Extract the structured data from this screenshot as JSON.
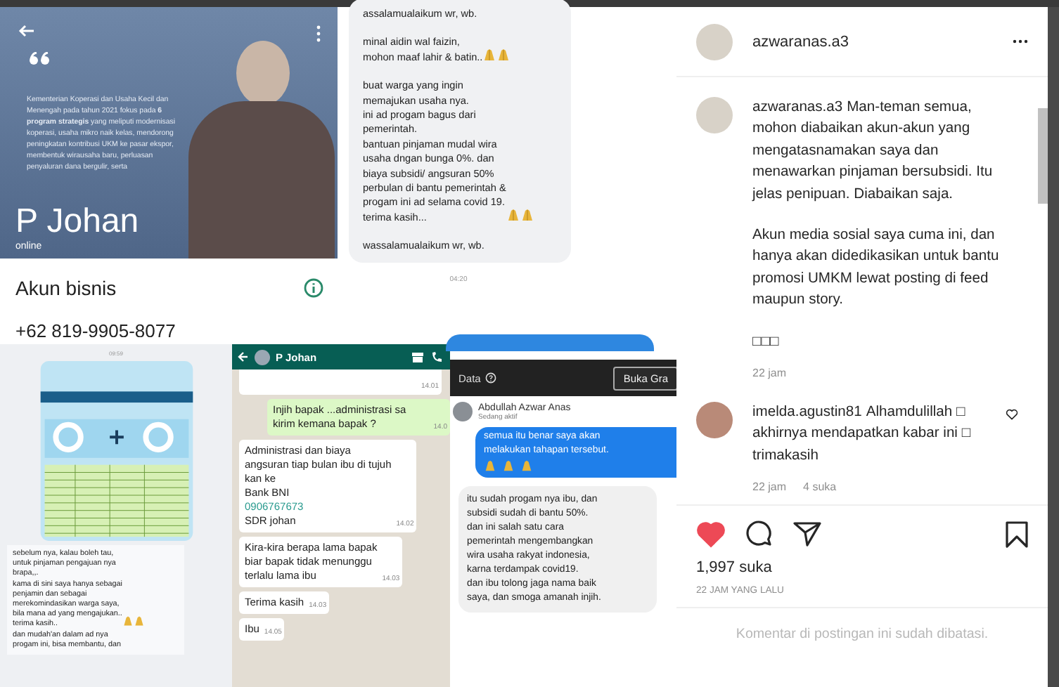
{
  "post_image": {
    "profile_card": {
      "quote": "Kementerian Koperasi dan Usaha Kecil dan Menengah pada tahun 2021 fokus pada **6 program strategis** yang meliputi modernisasi koperasi, usaha mikro naik kelas, mendorong peningkatan kontribusi UKM ke pasar ekspor, membentuk wirausaha baru, perluasan penyaluran dana bergulir, serta",
      "name": "P Johan",
      "status": "online",
      "section_title": "Akun bisnis",
      "phone": "+62 819-9905-8077"
    },
    "message_card": {
      "paragraphs": [
        {
          "lines": [
            "assalamualaikum wr, wb."
          ]
        },
        {
          "lines": [
            "minal aidin wal faizin,",
            "mohon maaf lahir & batin.."
          ],
          "icons": [
            {
              "kind": "pray"
            },
            {
              "kind": "pray"
            }
          ]
        },
        {
          "lines": [
            "buat warga yang ingin",
            "memajukan usaha nya.",
            "ini ad progam bagus dari",
            "pemerintah.",
            "bantuan pinjaman mudal wira",
            "usaha dngan bunga 0%. dan",
            "biaya subsidi/ angsuran 50%",
            "perbulan di bantu pemerintah &",
            "progam ini ad selama covid 19.",
            "terima kasih..."
          ],
          "icons": [
            {
              "kind": "pray"
            },
            {
              "kind": "pray"
            }
          ]
        },
        {
          "lines": [
            "wassalamualaikum wr, wb."
          ]
        }
      ],
      "time": "04:20"
    },
    "request_card": {
      "time": "09:59",
      "paragraphs": [
        {
          "lines": [
            "sebelum nya, kalau boleh tau,",
            "untuk pinjaman pengajuan nya",
            "brapa,,.",
            "kama di sini saya hanya sebagai",
            "penjamin dan sebagai",
            "merekomindasikan warga saya,",
            "bila mana ad yang mengajukan..",
            "terima kasih.."
          ],
          "icons": [
            {
              "kind": "pray"
            },
            {
              "kind": "pray"
            }
          ]
        },
        {
          "lines": [
            "dan mudah'an dalam ad nya",
            "progam ini, bisa membantu, dan"
          ]
        }
      ]
    },
    "whatsapp_chat": {
      "contact": "P Johan",
      "messages": [
        {
          "kind": "incoming",
          "time": "14.01"
        },
        {
          "kind": "outgoing",
          "lines": [
            "Injih bapak ...administrasi sa",
            "kirim kemana bapak ?"
          ],
          "time": "14.0"
        },
        {
          "kind": "incoming",
          "lines": [
            "Administrasi dan biaya",
            "angsuran tiap bulan ibu di tujuh",
            "kan ke",
            "Bank BNI"
          ],
          "link": "0906767673",
          "after": [
            "SDR johan"
          ],
          "time": "14.02"
        },
        {
          "kind": "incoming",
          "lines": [
            "Kira-kira berapa lama bapak",
            "biar bapak tidak menunggu",
            "terlalu lama ibu"
          ],
          "time": "14.03"
        },
        {
          "kind": "incoming",
          "lines": [
            "Terima kasih"
          ],
          "time": "14.03"
        },
        {
          "kind": "incoming",
          "lines": [
            "Ibu"
          ],
          "time": "14.05"
        }
      ]
    },
    "messenger_chat": {
      "toolbar_label": "Data",
      "toolbar_button": "Buka Gra",
      "contact": "Abdullah Azwar Anas",
      "status": "Sedang aktif",
      "messages": [
        {
          "kind": "outgoing",
          "lines": [
            "semua itu benar saya akan",
            "melakukan tahapan tersebut."
          ],
          "icons": [
            {
              "kind": "pray"
            },
            {
              "kind": "pray"
            },
            {
              "kind": "pray"
            }
          ]
        },
        {
          "kind": "incoming",
          "lines": [
            "itu sudah progam nya ibu, dan",
            "subsidi sudah di bantu 50%.",
            "dan ini salah satu cara",
            "pemerintah mengembangkan",
            "wira usaha rakyat indonesia,",
            "karna terdampak covid19.",
            "dan ibu tolong jaga nama baik",
            "saya, dan smoga amanah injih."
          ]
        }
      ]
    }
  },
  "post_panel": {
    "username": "azwaranas.a3",
    "comments": [
      {
        "kind": "caption",
        "author": "azwaranas.a3",
        "paragraphs": [
          "Man-teman semua, mohon diabaikan akun-akun yang mengatasnamakan saya dan menawarkan pinjaman bersubsidi. Itu jelas penipuan. Diabaikan saja.",
          "Akun media sosial saya cuma ini, dan hanya akan didedikasikan untuk bantu promosi UMKM lewat posting di feed maupun story.",
          "□□□"
        ],
        "time": "22 jam"
      },
      {
        "kind": "comment",
        "author": "imelda.agustin81",
        "paragraphs": [
          "Alhamdulillah □ akhirnya mendapatkan kabar ini □ trimakasih"
        ],
        "time": "22 jam",
        "likes": "4 suka"
      }
    ],
    "liked": true,
    "saved": false,
    "likes": "1,997 suka",
    "posted": "22 JAM YANG LALU",
    "footer": "Komentar di postingan ini sudah dibatasi."
  }
}
